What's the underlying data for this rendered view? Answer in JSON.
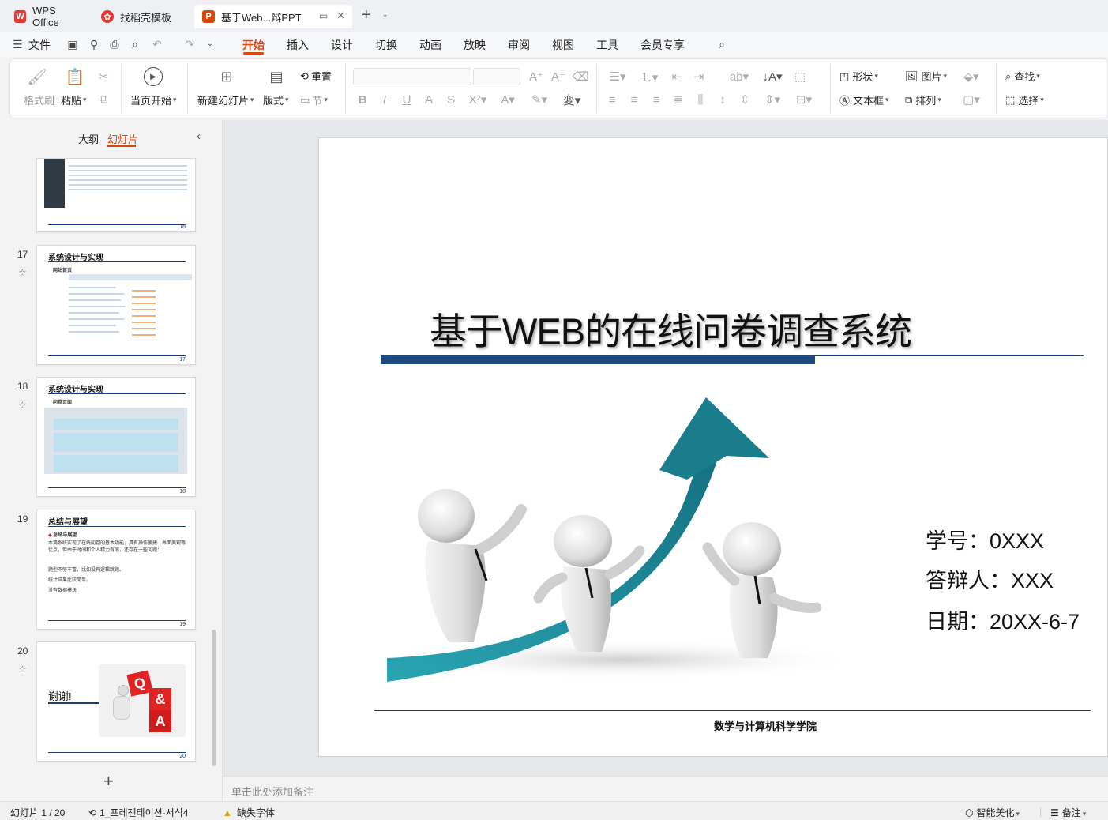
{
  "tabs": [
    {
      "label": "WPS Office",
      "icon": "wps-logo-icon"
    },
    {
      "label": "找稻壳模板",
      "icon": "daoke-icon"
    },
    {
      "label": "基于Web...辩PPT",
      "icon": "ppt-file-icon"
    }
  ],
  "menu": {
    "file": "文件",
    "items": [
      "开始",
      "插入",
      "设计",
      "切换",
      "动画",
      "放映",
      "审阅",
      "视图",
      "工具",
      "会员专享"
    ],
    "active": "开始"
  },
  "ribbon": {
    "format_painter": "格式刷",
    "paste": "粘贴",
    "play_from_current": "当页开始",
    "new_slide": "新建幻灯片",
    "layout": "版式",
    "reset": "重置",
    "section": "节",
    "shape": "形状",
    "picture": "图片",
    "textbox": "文本框",
    "arrange": "排列",
    "find": "查找",
    "select": "选择"
  },
  "panel": {
    "tab_outline": "大纲",
    "tab_slides": "幻灯片"
  },
  "thumbnails": [
    {
      "num": "16",
      "page_label": "16"
    },
    {
      "num": "17",
      "title": "系统设计与实现",
      "subtitle": "网站首页",
      "page_label": "17"
    },
    {
      "num": "18",
      "title": "系统设计与实现",
      "subtitle": "问卷页面",
      "page_label": "18"
    },
    {
      "num": "19",
      "title": "总结与展望",
      "subtitle": "总结与展望",
      "bullets": [
        "本篇系统实现了在线问卷的基本功能，具有操作便捷、界面美观等优点，但由于时间和个人精力有限，还存在一些问题：",
        "题型不够丰富，比如没有逻辑跳题。",
        "统计结果比较简单。",
        "没有数据模块"
      ],
      "page_label": "19"
    },
    {
      "num": "20",
      "title": "谢谢!",
      "qa_letters": [
        "Q",
        "&",
        "A"
      ],
      "page_label": "20"
    }
  ],
  "slide": {
    "title": "基于WEB的在线问卷调查系统",
    "student_id": "学号：0XXX",
    "presenter": "答辩人：XXX",
    "date": "日期：20XX-6-7",
    "school": "数学与计算机科学学院"
  },
  "notes_placeholder": "单击此处添加备注",
  "status": {
    "slide_counter": "幻灯片 1 / 20",
    "theme": "1_프레젠테이션-서식4",
    "missing_font": "缺失字体",
    "smart_beautify": "智能美化",
    "notes": "备注"
  },
  "colors": {
    "accent": "#d9480f",
    "navy": "#1f3f72",
    "teal": "#1f8a99"
  }
}
